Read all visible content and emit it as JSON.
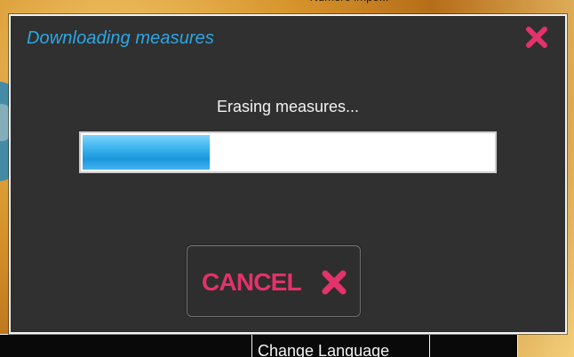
{
  "dialog": {
    "title": "Downloading measures",
    "status_text": "Erasing measures...",
    "progress_fraction": 0.31,
    "cancel_label": "CANCEL"
  },
  "background": {
    "top_text": "Numero\nimpo...",
    "bottom_cell_text": "Change Language"
  },
  "icons": {
    "close": "close-icon",
    "cancel": "cancel-icon"
  },
  "colors": {
    "dialog_bg": "#303030",
    "title": "#28a8e8",
    "accent": "#e2336b",
    "progress_blue": "#1a97dd",
    "text": "#f2f2f2",
    "border": "#f4f4f4"
  }
}
